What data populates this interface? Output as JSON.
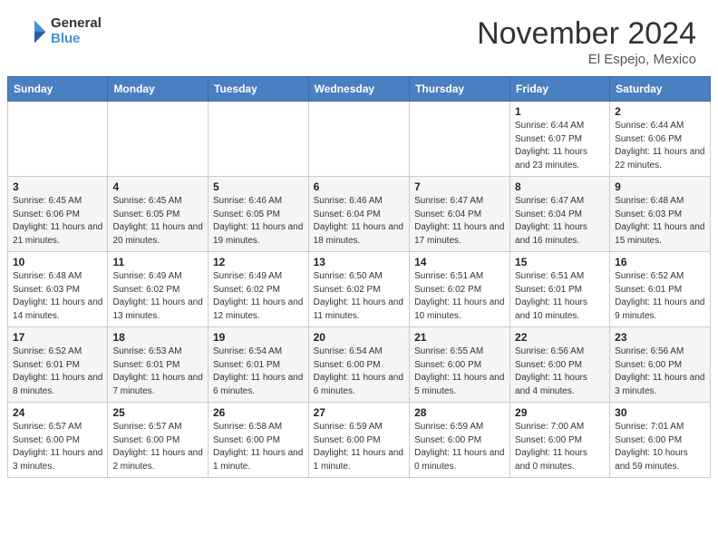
{
  "logo": {
    "general": "General",
    "blue": "Blue"
  },
  "header": {
    "title": "November 2024",
    "location": "El Espejo, Mexico"
  },
  "weekdays": [
    "Sunday",
    "Monday",
    "Tuesday",
    "Wednesday",
    "Thursday",
    "Friday",
    "Saturday"
  ],
  "weeks": [
    [
      {
        "day": "",
        "sunrise": "",
        "sunset": "",
        "daylight": ""
      },
      {
        "day": "",
        "sunrise": "",
        "sunset": "",
        "daylight": ""
      },
      {
        "day": "",
        "sunrise": "",
        "sunset": "",
        "daylight": ""
      },
      {
        "day": "",
        "sunrise": "",
        "sunset": "",
        "daylight": ""
      },
      {
        "day": "",
        "sunrise": "",
        "sunset": "",
        "daylight": ""
      },
      {
        "day": "1",
        "sunrise": "Sunrise: 6:44 AM",
        "sunset": "Sunset: 6:07 PM",
        "daylight": "Daylight: 11 hours and 23 minutes."
      },
      {
        "day": "2",
        "sunrise": "Sunrise: 6:44 AM",
        "sunset": "Sunset: 6:06 PM",
        "daylight": "Daylight: 11 hours and 22 minutes."
      }
    ],
    [
      {
        "day": "3",
        "sunrise": "Sunrise: 6:45 AM",
        "sunset": "Sunset: 6:06 PM",
        "daylight": "Daylight: 11 hours and 21 minutes."
      },
      {
        "day": "4",
        "sunrise": "Sunrise: 6:45 AM",
        "sunset": "Sunset: 6:05 PM",
        "daylight": "Daylight: 11 hours and 20 minutes."
      },
      {
        "day": "5",
        "sunrise": "Sunrise: 6:46 AM",
        "sunset": "Sunset: 6:05 PM",
        "daylight": "Daylight: 11 hours and 19 minutes."
      },
      {
        "day": "6",
        "sunrise": "Sunrise: 6:46 AM",
        "sunset": "Sunset: 6:04 PM",
        "daylight": "Daylight: 11 hours and 18 minutes."
      },
      {
        "day": "7",
        "sunrise": "Sunrise: 6:47 AM",
        "sunset": "Sunset: 6:04 PM",
        "daylight": "Daylight: 11 hours and 17 minutes."
      },
      {
        "day": "8",
        "sunrise": "Sunrise: 6:47 AM",
        "sunset": "Sunset: 6:04 PM",
        "daylight": "Daylight: 11 hours and 16 minutes."
      },
      {
        "day": "9",
        "sunrise": "Sunrise: 6:48 AM",
        "sunset": "Sunset: 6:03 PM",
        "daylight": "Daylight: 11 hours and 15 minutes."
      }
    ],
    [
      {
        "day": "10",
        "sunrise": "Sunrise: 6:48 AM",
        "sunset": "Sunset: 6:03 PM",
        "daylight": "Daylight: 11 hours and 14 minutes."
      },
      {
        "day": "11",
        "sunrise": "Sunrise: 6:49 AM",
        "sunset": "Sunset: 6:02 PM",
        "daylight": "Daylight: 11 hours and 13 minutes."
      },
      {
        "day": "12",
        "sunrise": "Sunrise: 6:49 AM",
        "sunset": "Sunset: 6:02 PM",
        "daylight": "Daylight: 11 hours and 12 minutes."
      },
      {
        "day": "13",
        "sunrise": "Sunrise: 6:50 AM",
        "sunset": "Sunset: 6:02 PM",
        "daylight": "Daylight: 11 hours and 11 minutes."
      },
      {
        "day": "14",
        "sunrise": "Sunrise: 6:51 AM",
        "sunset": "Sunset: 6:02 PM",
        "daylight": "Daylight: 11 hours and 10 minutes."
      },
      {
        "day": "15",
        "sunrise": "Sunrise: 6:51 AM",
        "sunset": "Sunset: 6:01 PM",
        "daylight": "Daylight: 11 hours and 10 minutes."
      },
      {
        "day": "16",
        "sunrise": "Sunrise: 6:52 AM",
        "sunset": "Sunset: 6:01 PM",
        "daylight": "Daylight: 11 hours and 9 minutes."
      }
    ],
    [
      {
        "day": "17",
        "sunrise": "Sunrise: 6:52 AM",
        "sunset": "Sunset: 6:01 PM",
        "daylight": "Daylight: 11 hours and 8 minutes."
      },
      {
        "day": "18",
        "sunrise": "Sunrise: 6:53 AM",
        "sunset": "Sunset: 6:01 PM",
        "daylight": "Daylight: 11 hours and 7 minutes."
      },
      {
        "day": "19",
        "sunrise": "Sunrise: 6:54 AM",
        "sunset": "Sunset: 6:01 PM",
        "daylight": "Daylight: 11 hours and 6 minutes."
      },
      {
        "day": "20",
        "sunrise": "Sunrise: 6:54 AM",
        "sunset": "Sunset: 6:00 PM",
        "daylight": "Daylight: 11 hours and 6 minutes."
      },
      {
        "day": "21",
        "sunrise": "Sunrise: 6:55 AM",
        "sunset": "Sunset: 6:00 PM",
        "daylight": "Daylight: 11 hours and 5 minutes."
      },
      {
        "day": "22",
        "sunrise": "Sunrise: 6:56 AM",
        "sunset": "Sunset: 6:00 PM",
        "daylight": "Daylight: 11 hours and 4 minutes."
      },
      {
        "day": "23",
        "sunrise": "Sunrise: 6:56 AM",
        "sunset": "Sunset: 6:00 PM",
        "daylight": "Daylight: 11 hours and 3 minutes."
      }
    ],
    [
      {
        "day": "24",
        "sunrise": "Sunrise: 6:57 AM",
        "sunset": "Sunset: 6:00 PM",
        "daylight": "Daylight: 11 hours and 3 minutes."
      },
      {
        "day": "25",
        "sunrise": "Sunrise: 6:57 AM",
        "sunset": "Sunset: 6:00 PM",
        "daylight": "Daylight: 11 hours and 2 minutes."
      },
      {
        "day": "26",
        "sunrise": "Sunrise: 6:58 AM",
        "sunset": "Sunset: 6:00 PM",
        "daylight": "Daylight: 11 hours and 1 minute."
      },
      {
        "day": "27",
        "sunrise": "Sunrise: 6:59 AM",
        "sunset": "Sunset: 6:00 PM",
        "daylight": "Daylight: 11 hours and 1 minute."
      },
      {
        "day": "28",
        "sunrise": "Sunrise: 6:59 AM",
        "sunset": "Sunset: 6:00 PM",
        "daylight": "Daylight: 11 hours and 0 minutes."
      },
      {
        "day": "29",
        "sunrise": "Sunrise: 7:00 AM",
        "sunset": "Sunset: 6:00 PM",
        "daylight": "Daylight: 11 hours and 0 minutes."
      },
      {
        "day": "30",
        "sunrise": "Sunrise: 7:01 AM",
        "sunset": "Sunset: 6:00 PM",
        "daylight": "Daylight: 10 hours and 59 minutes."
      }
    ]
  ]
}
